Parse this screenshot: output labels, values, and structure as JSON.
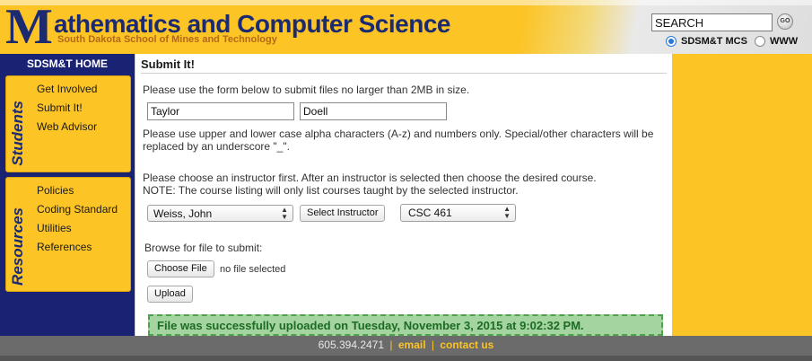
{
  "header": {
    "logo_letter": "M",
    "title": "athematics and Computer Science",
    "subtitle": "South Dakota School of Mines and Technology",
    "search_value": "SEARCH",
    "go_label": "GO",
    "radio_options": [
      "SDSM&T MCS",
      "WWW"
    ],
    "radio_selected": "SDSM&T MCS"
  },
  "sidebar": {
    "home": "SDSM&T HOME",
    "students": {
      "label": "Students",
      "items": [
        "Get Involved",
        "Submit It!",
        "Web Advisor"
      ]
    },
    "resources": {
      "label": "Resources",
      "items": [
        "Policies",
        "Coding Standard",
        "Utilities",
        "References"
      ]
    }
  },
  "main": {
    "title": "Submit It!",
    "intro": "Please use the form below to submit files no larger than 2MB in size.",
    "first_name": "Taylor",
    "last_name": "Doell",
    "name_note_line1": "Please use upper and lower case alpha characters (A-z) and numbers only. Special/other characters will be",
    "name_note_line2": "replaced by an underscore \"_\".",
    "instructor_note_line1": "Please choose an instructor first. After an instructor is selected then choose the desired course.",
    "instructor_note_line2": "NOTE: The course listing will only list courses taught by the selected instructor.",
    "instructor_selected": "Weiss, John",
    "select_instructor_button": "Select Instructor",
    "course_selected": "CSC 461",
    "browse_label": "Browse for file to submit:",
    "choose_file_button": "Choose File",
    "file_status": "no file selected",
    "upload_button": "Upload",
    "success_message": "File was successfully uploaded on Tuesday, November 3, 2015 at 9:02:32 PM."
  },
  "footer": {
    "phone": "605.394.2471",
    "separator": "|",
    "email": "email",
    "contact": "contact us"
  },
  "colors": {
    "gold": "#fcc425",
    "navy": "#1a2274",
    "success_bg": "#a4d4a0",
    "success_text": "#1d6b23"
  }
}
